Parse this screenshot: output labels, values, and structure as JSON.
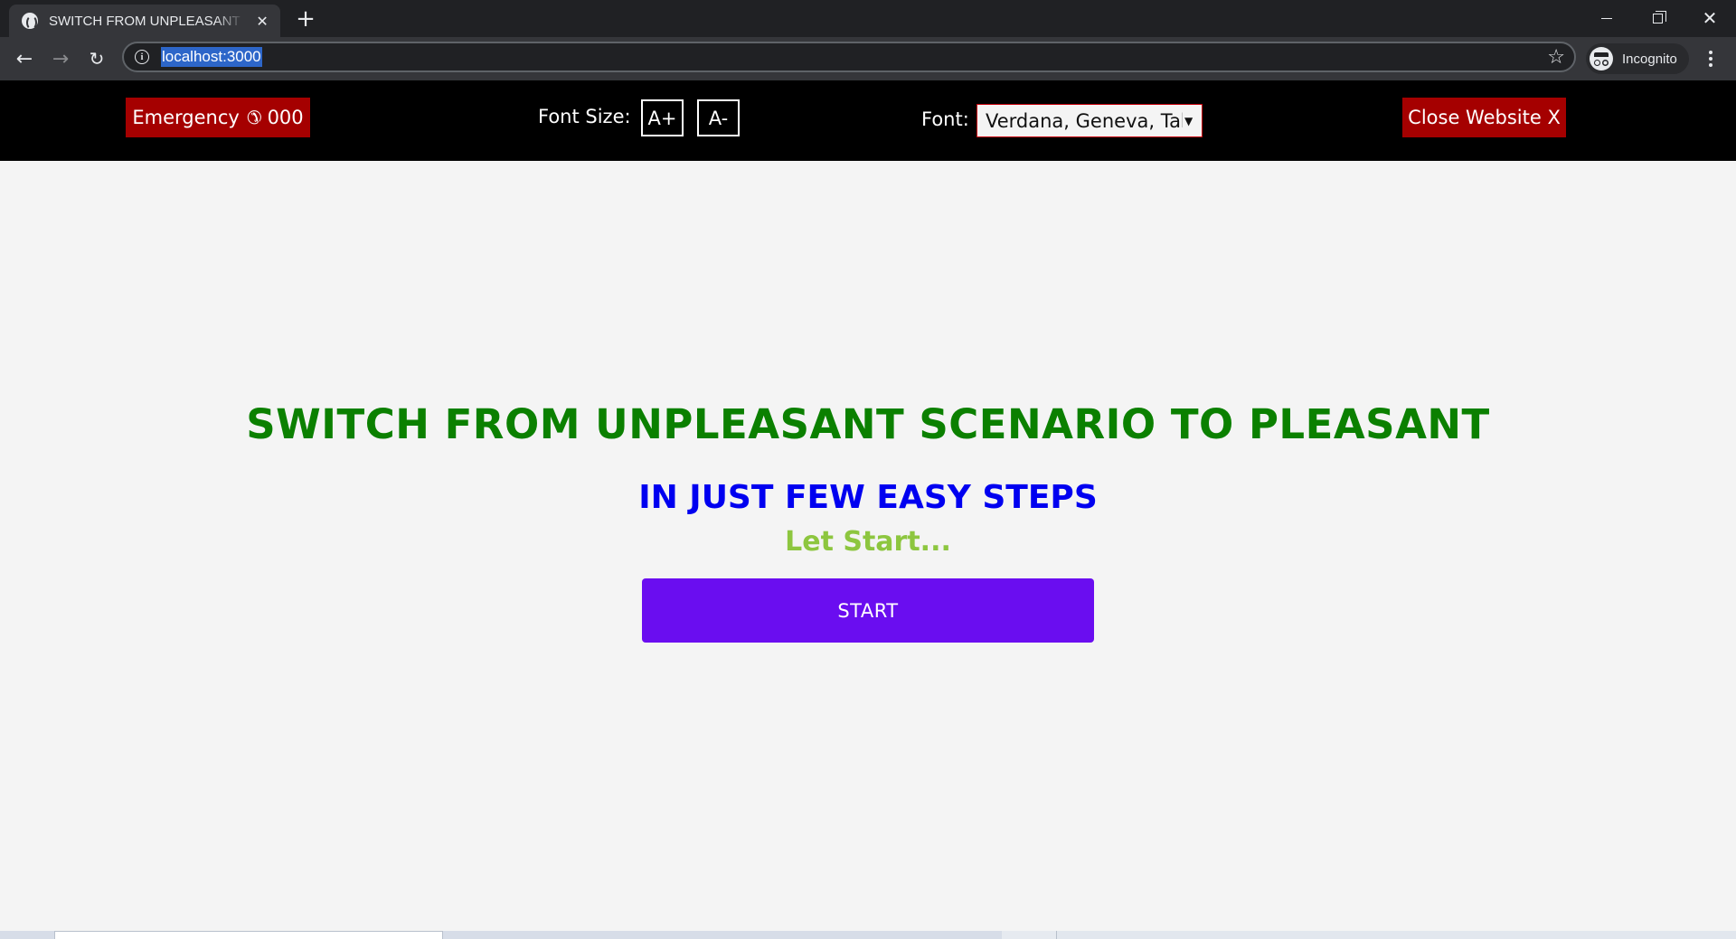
{
  "browser": {
    "tab_title": "SWITCH FROM UNPLEASANT SCENARIO TO PLEASANT",
    "tab_close_glyph": "✕",
    "new_tab_glyph": "+",
    "url": "localhost:3000",
    "profile_label": "Incognito",
    "icons": [
      "globe-icon",
      "close-icon",
      "plus-icon",
      "minimize-icon",
      "maximize-icon",
      "back-arrow-icon",
      "forward-arrow-icon",
      "reload-icon",
      "info-icon",
      "star-icon",
      "incognito-icon",
      "kebab-menu-icon"
    ]
  },
  "header": {
    "emergency_label": "Emergency",
    "emergency_number": "000",
    "phone_glyph": "✆",
    "font_size_label": "Font Size:",
    "increase_label": "A+",
    "decrease_label": "A-",
    "font_label": "Font:",
    "font_selected": "Verdana, Geneva, Tahoma, sans-serif",
    "caret_glyph": "▼",
    "close_website_label": "Close Website X",
    "colors": {
      "background": "#000000",
      "danger": "#a50000"
    }
  },
  "main": {
    "title": "SWITCH FROM UNPLEASANT SCENARIO TO PLEASANT",
    "subtitle": "IN JUST FEW EASY STEPS",
    "tagline": "Let Start...",
    "start_label": "START",
    "colors": {
      "title": "#0b8000",
      "subtitle": "#0000f0",
      "tagline": "#8dc63f",
      "start_button": "#6a0df0",
      "page_background": "#f4f4f4"
    }
  }
}
